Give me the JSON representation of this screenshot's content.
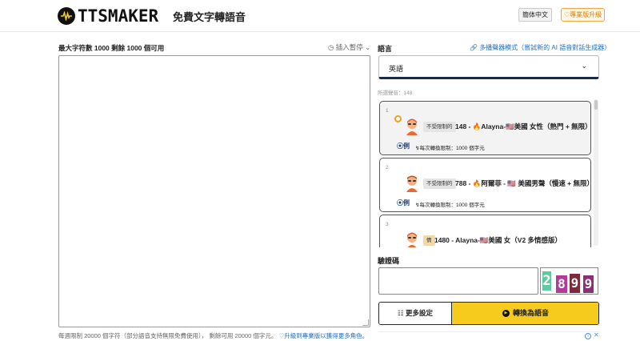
{
  "header": {
    "logo_text": "TTSMAKER",
    "tagline": "免費文字轉語音",
    "language_button": "簡体中文",
    "pro_button": "♡專業版升級"
  },
  "editor": {
    "char_info": "最大字符數 1000 剩餘 1000 個可用",
    "insert_pause": "◷ 插入暫停 ⌄",
    "text_value": "",
    "footer_note": "每週限制 20000 個字符（部分語音支持無限免費使用）， 剩餘可用 20000 個字元。",
    "footer_upgrade": "♡升級到專業版以獲得更多角色。"
  },
  "language": {
    "label": "語言",
    "multi_voice_link": "多播聲器模式（嘗試新的 AI 語音對話生成器）",
    "selected": "英語",
    "voice_count": "所選聲音：148"
  },
  "voices": [
    {
      "num": "1",
      "badge": "不受限制的",
      "name": "148 - 🔥Alayna-🇺🇸美國 女性（熱門 + 無限）",
      "play": "⦿例",
      "limit": "↯每次轉換限制：1000 個字元",
      "selected": true
    },
    {
      "num": "2",
      "badge": "不受限制的",
      "name": "788 - 🔥阿爾菲 - 🇺🇸 美國男聲（慢速 + 無限）",
      "play": "⦿例",
      "limit": "↯每次轉換限制：1000 個字元",
      "selected": false
    },
    {
      "num": "3",
      "badge": "情",
      "name": "1480 - Alayna-🇺🇸美國 女（V2 多情感版）",
      "play": "",
      "limit": "",
      "selected": false
    }
  ],
  "captcha": {
    "label": "驗證碼",
    "input_value": "",
    "digits": [
      "2",
      "8",
      "9",
      "9"
    ],
    "digit_colors": [
      "#5fc9a0",
      "#b23a9a",
      "#7a2a3a",
      "#8e2f73"
    ]
  },
  "actions": {
    "more_settings": "☷ 更多設定",
    "convert": "轉換為語音",
    "convert_icon": "▶"
  },
  "colors": {
    "accent_yellow": "#f7cb1e",
    "navy": "#1a2b45",
    "link_blue": "#1f6fc5",
    "pro_orange": "#e07b00"
  }
}
